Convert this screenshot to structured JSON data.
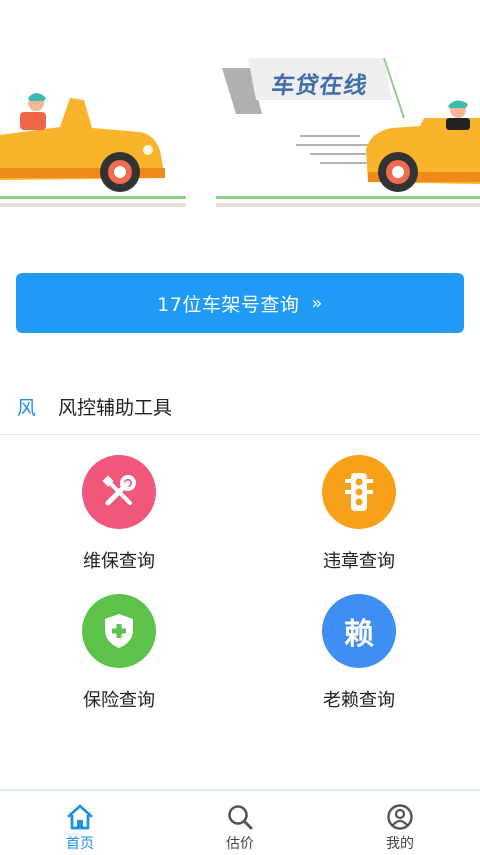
{
  "banner": {
    "title": "车贷在线"
  },
  "vin_query": {
    "label": "17位车架号查询",
    "chevron": "»"
  },
  "section": {
    "mark": "风",
    "title": "风控辅助工具"
  },
  "tools": [
    {
      "label": "维保查询",
      "icon": "wrench-screwdriver-icon",
      "color": "#f0587b"
    },
    {
      "label": "违章查询",
      "icon": "traffic-light-icon",
      "color": "#f7a11a"
    },
    {
      "label": "保险查询",
      "icon": "shield-plus-icon",
      "color": "#5cc24a"
    },
    {
      "label": "老赖查询",
      "icon": "lai-character-icon",
      "glyph": "赖",
      "color": "#3e8ef3"
    }
  ],
  "tabs": [
    {
      "label": "首页",
      "icon": "home-icon",
      "active": true
    },
    {
      "label": "估价",
      "icon": "search-icon",
      "active": false
    },
    {
      "label": "我的",
      "icon": "user-icon",
      "active": false
    }
  ],
  "colors": {
    "primary": "#1f9bf6",
    "text": "#222222"
  }
}
